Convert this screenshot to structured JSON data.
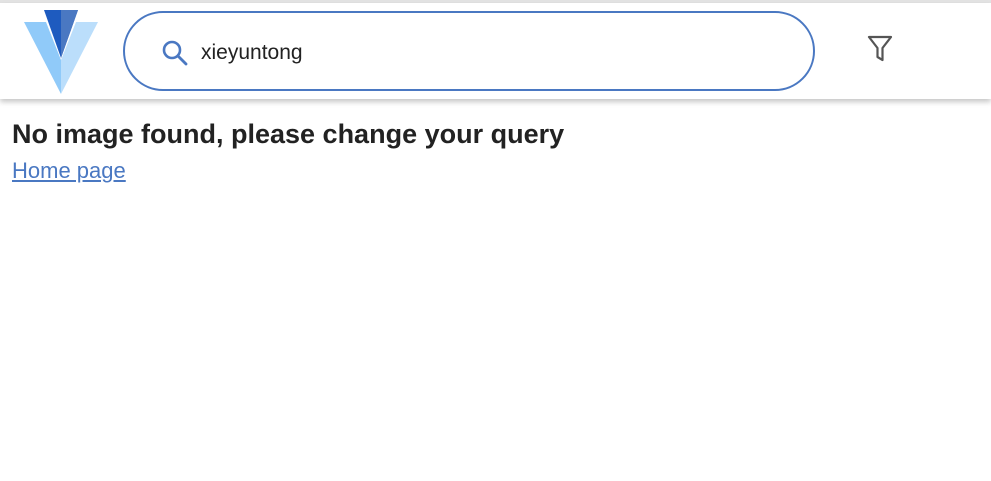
{
  "search": {
    "value": "xieyuntong",
    "icon": "search-icon"
  },
  "filter": {
    "icon": "filter-icon"
  },
  "logo": {
    "icon": "logo-icon",
    "colors": {
      "light": "#90caf9",
      "medium": "#bbdefb",
      "dark": "#1e5bbf"
    }
  },
  "content": {
    "message": "No image found, please change your query",
    "home_link": "Home page"
  },
  "colors": {
    "accent": "#4a78c2",
    "text": "#222222"
  }
}
